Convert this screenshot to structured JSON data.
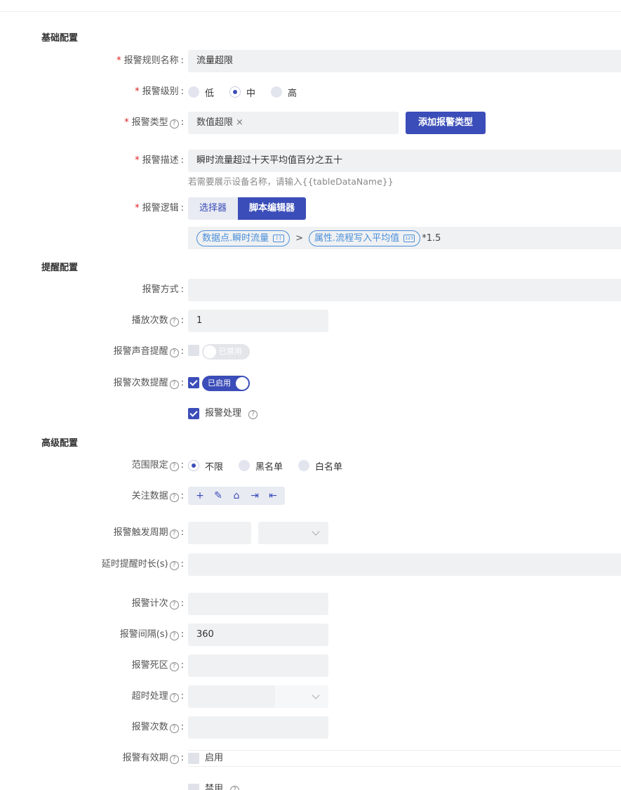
{
  "sections": {
    "basic": "基础配置",
    "remind": "提醒配置",
    "advanced": "高级配置"
  },
  "basic": {
    "rule_name": {
      "label": "报警规则名称",
      "value": "流量超限"
    },
    "level": {
      "label": "报警级别",
      "options": [
        "低",
        "中",
        "高"
      ],
      "selected": "中"
    },
    "type": {
      "label": "报警类型",
      "tag": "数值超限",
      "add_button": "添加报警类型"
    },
    "description": {
      "label": "报警描述",
      "value": "瞬时流量超过十天平均值百分之五十",
      "hint": "若需要展示设备名称，请输入{{tableDataName}}"
    },
    "logic": {
      "label": "报警逻辑",
      "tabs": [
        "选择器",
        "脚本编辑器"
      ],
      "active_tab": "脚本编辑器",
      "expr_left": "数据点.瞬时流量",
      "expr_op": ">",
      "expr_right": "属性.流程写入平均值",
      "expr_right_badge": "123",
      "expr_suffix": "*1.5"
    }
  },
  "remind": {
    "method": {
      "label": "报警方式",
      "value": ""
    },
    "play_count": {
      "label": "播放次数",
      "value": "1"
    },
    "sound": {
      "label": "报警声音提醒",
      "switch_text": "已禁用",
      "enabled": false
    },
    "count_remind": {
      "label": "报警次数提醒",
      "switch_text": "已启用",
      "enabled": true
    },
    "handle": {
      "label": "报警处理",
      "checked": true
    }
  },
  "advanced": {
    "scope": {
      "label": "范围限定",
      "options": [
        "不限",
        "黑名单",
        "白名单"
      ],
      "selected": "不限"
    },
    "focus": {
      "label": "关注数据",
      "tools": [
        "+",
        "✎",
        "⌂",
        "⇥",
        "⇤"
      ]
    },
    "trigger_period": {
      "label": "报警触发周期"
    },
    "delay": {
      "label": "延时提醒时长(s)"
    },
    "count": {
      "label": "报警计次"
    },
    "interval": {
      "label": "报警间隔(s)",
      "value": "360"
    },
    "deadband": {
      "label": "报警死区"
    },
    "timeout": {
      "label": "超时处理"
    },
    "times": {
      "label": "报警次数"
    },
    "validity": {
      "label": "报警有效期",
      "option": "启用"
    },
    "disable": {
      "label": "禁用"
    }
  },
  "colors": {
    "primary": "#3b4db8",
    "required": "#e02020",
    "field_bg": "#f0f1f3",
    "link": "#4a8fd8"
  }
}
